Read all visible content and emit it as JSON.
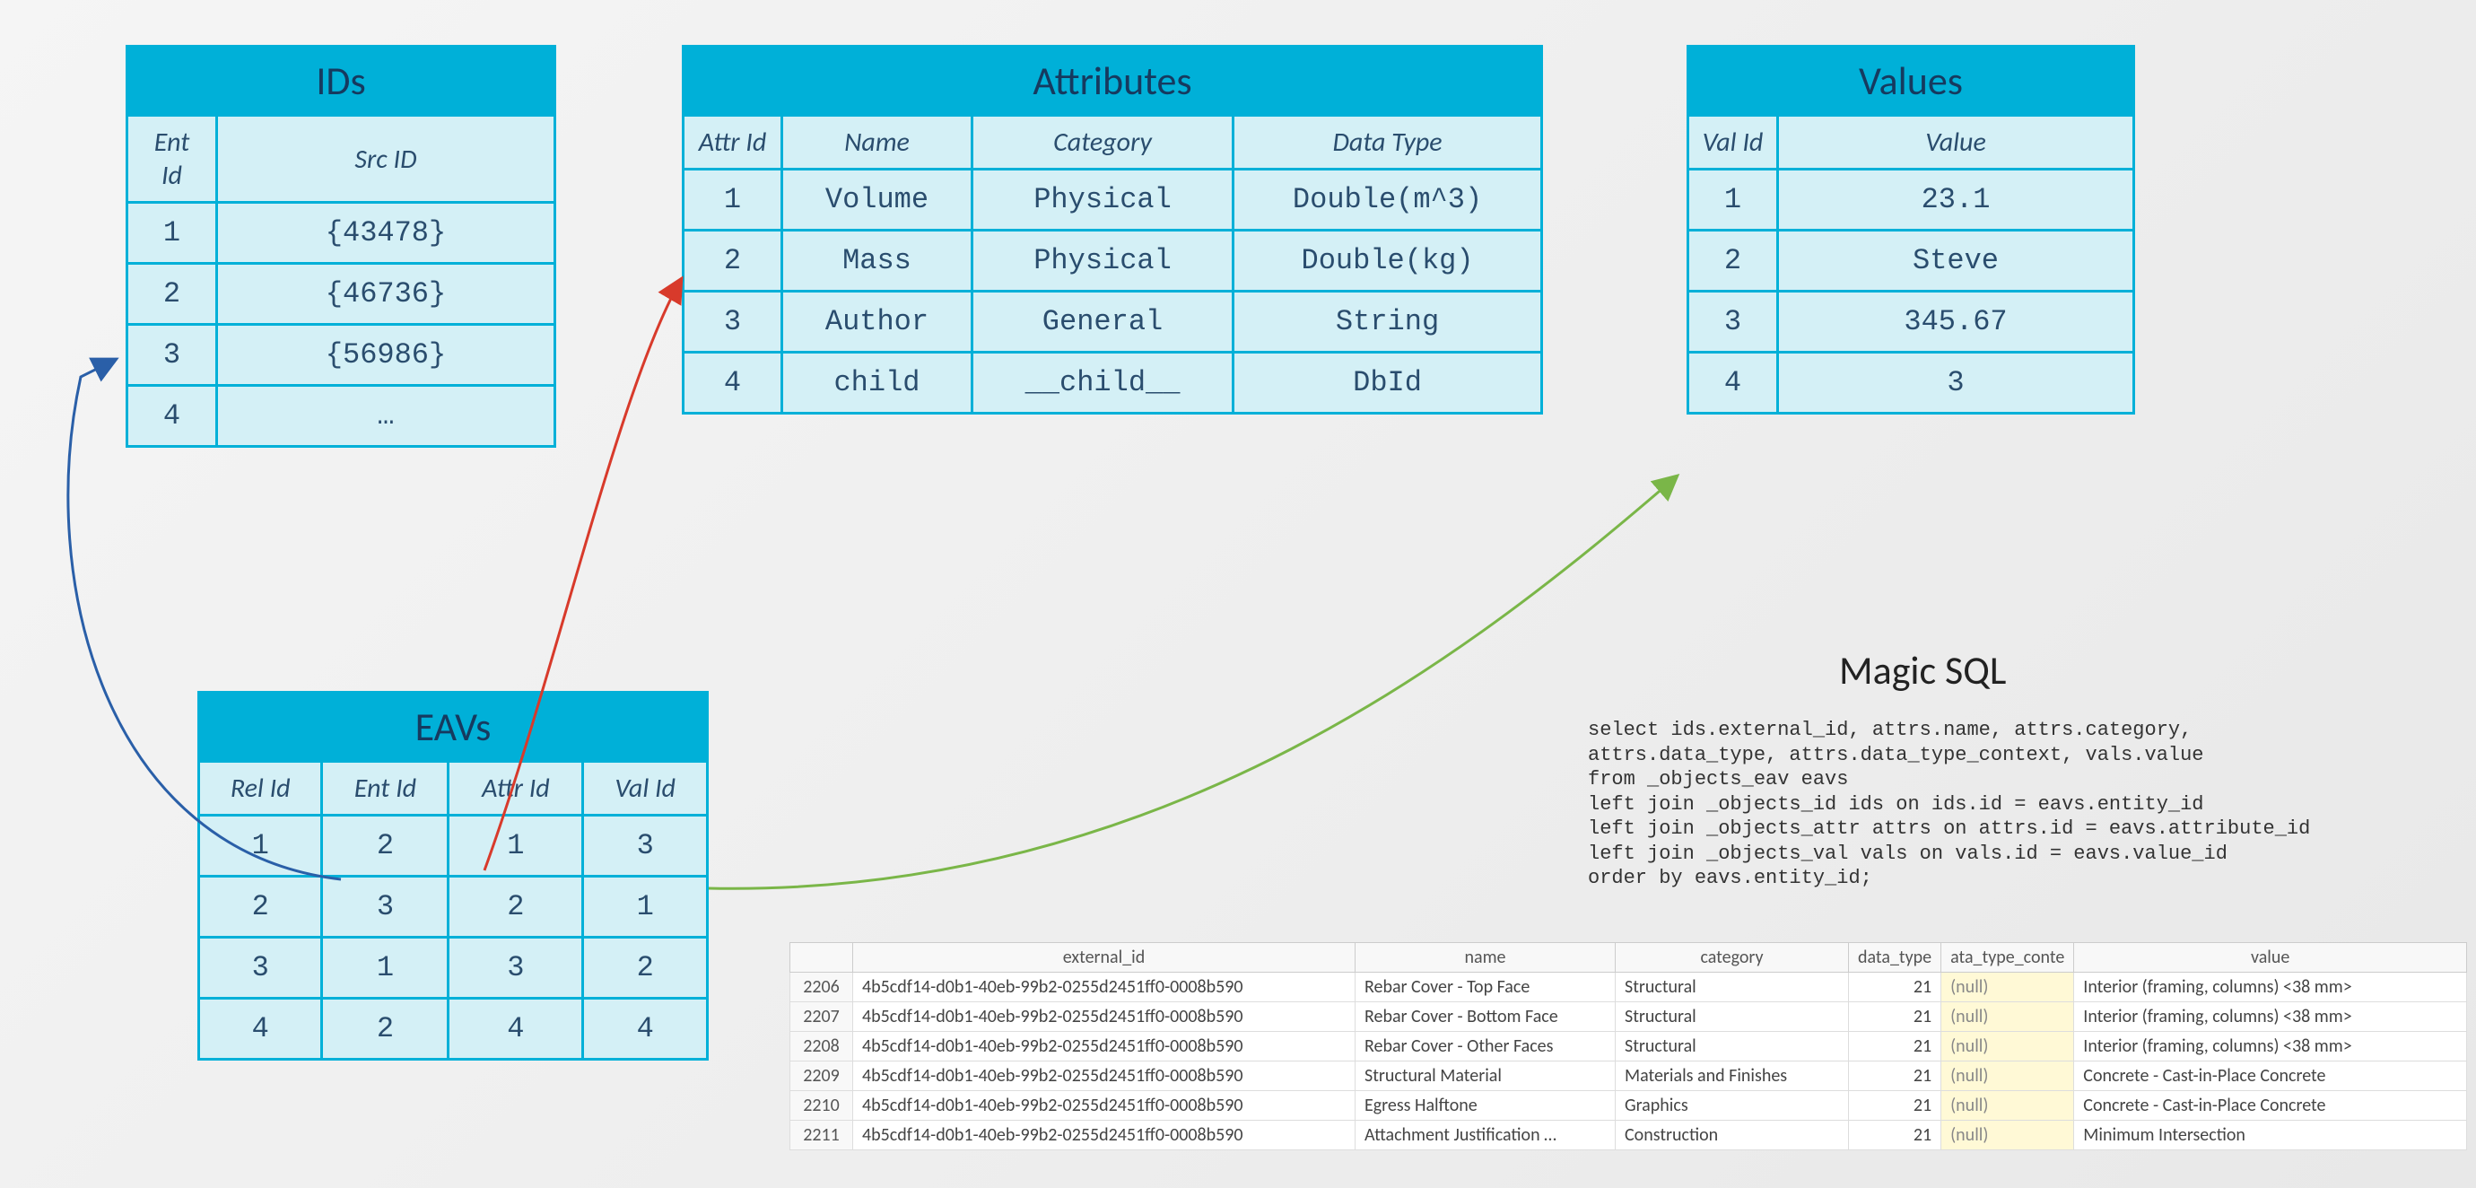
{
  "ids_table": {
    "title": "IDs",
    "headers": [
      "Ent Id",
      "Src ID"
    ],
    "rows": [
      [
        "1",
        "{43478}"
      ],
      [
        "2",
        "{46736}"
      ],
      [
        "3",
        "{56986}"
      ],
      [
        "4",
        "…"
      ]
    ]
  },
  "attributes_table": {
    "title": "Attributes",
    "headers": [
      "Attr Id",
      "Name",
      "Category",
      "Data Type"
    ],
    "rows": [
      [
        "1",
        "Volume",
        "Physical",
        "Double(m^3)"
      ],
      [
        "2",
        "Mass",
        "Physical",
        "Double(kg)"
      ],
      [
        "3",
        "Author",
        "General",
        "String"
      ],
      [
        "4",
        "child",
        "__child__",
        "DbId"
      ]
    ]
  },
  "values_table": {
    "title": "Values",
    "headers": [
      "Val Id",
      "Value"
    ],
    "rows": [
      [
        "1",
        "23.1"
      ],
      [
        "2",
        "Steve"
      ],
      [
        "3",
        "345.67"
      ],
      [
        "4",
        "3"
      ]
    ]
  },
  "eavs_table": {
    "title": "EAVs",
    "headers": [
      "Rel Id",
      "Ent Id",
      "Attr Id",
      "Val Id"
    ],
    "rows": [
      [
        "1",
        "2",
        "1",
        "3"
      ],
      [
        "2",
        "3",
        "2",
        "1"
      ],
      [
        "3",
        "1",
        "3",
        "2"
      ],
      [
        "4",
        "2",
        "4",
        "4"
      ]
    ]
  },
  "magic_sql": {
    "title": "Magic SQL",
    "code": "select ids.external_id, attrs.name, attrs.category,\nattrs.data_type, attrs.data_type_context, vals.value\nfrom _objects_eav eavs\nleft join _objects_id ids on ids.id = eavs.entity_id\nleft join _objects_attr attrs on attrs.id = eavs.attribute_id\nleft join _objects_val vals on vals.id = eavs.value_id\norder by eavs.entity_id;"
  },
  "result_grid": {
    "headers": [
      "",
      "external_id",
      "name",
      "category",
      "data_type",
      "ata_type_conte",
      "value"
    ],
    "rows": [
      [
        "2206",
        "4b5cdf14-d0b1-40eb-99b2-0255d2451ff0-0008b590",
        "Rebar Cover - Top Face",
        "Structural",
        "21",
        "(null)",
        "Interior (framing, columns) <38 mm>"
      ],
      [
        "2207",
        "4b5cdf14-d0b1-40eb-99b2-0255d2451ff0-0008b590",
        "Rebar Cover - Bottom Face",
        "Structural",
        "21",
        "(null)",
        "Interior (framing, columns) <38 mm>"
      ],
      [
        "2208",
        "4b5cdf14-d0b1-40eb-99b2-0255d2451ff0-0008b590",
        "Rebar Cover - Other Faces",
        "Structural",
        "21",
        "(null)",
        "Interior (framing, columns) <38 mm>"
      ],
      [
        "2209",
        "4b5cdf14-d0b1-40eb-99b2-0255d2451ff0-0008b590",
        "Structural Material",
        "Materials and Finishes",
        "21",
        "(null)",
        "Concrete - Cast-in-Place Concrete"
      ],
      [
        "2210",
        "4b5cdf14-d0b1-40eb-99b2-0255d2451ff0-0008b590",
        "Egress Halftone",
        "Graphics",
        "21",
        "(null)",
        "Concrete - Cast-in-Place Concrete"
      ],
      [
        "2211",
        "4b5cdf14-d0b1-40eb-99b2-0255d2451ff0-0008b590",
        "Attachment Justification …",
        "Construction",
        "21",
        "(null)",
        "Minimum Intersection"
      ]
    ]
  }
}
